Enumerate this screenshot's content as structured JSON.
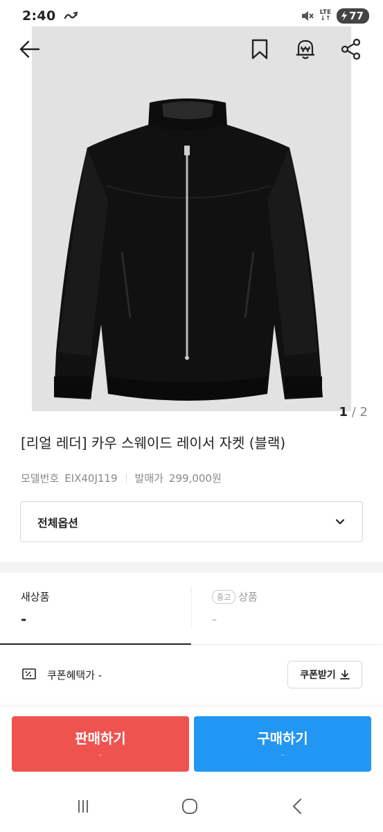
{
  "status_bar": {
    "time": "2:40",
    "network": "LTE",
    "battery": "77"
  },
  "hero": {
    "page_current": "1",
    "page_separator": "/",
    "page_total": "2",
    "icons": [
      "back-arrow-icon",
      "bookmark-icon",
      "price-alert-icon",
      "share-icon"
    ]
  },
  "product": {
    "title": "[리얼 레더] 카우 스웨이드 레이서 자켓 (블랙)",
    "model_label": "모델번호",
    "model_number": "EIX40J119",
    "release_price_label": "발매가",
    "release_price": "299,000원",
    "option_label": "전체옵션"
  },
  "tabs": [
    {
      "title": "새상품",
      "price": "-",
      "active": true
    },
    {
      "badge": "중고",
      "title": "상품",
      "price": "-",
      "active": false
    }
  ],
  "coupon": {
    "text": "쿠폰혜택가 -",
    "button": "쿠폰받기"
  },
  "actions": {
    "sell_label": "판매하기",
    "sell_sub": "-",
    "buy_label": "구매하기",
    "buy_sub": "-",
    "sell_color": "#ef5350",
    "buy_color": "#2196f3"
  }
}
